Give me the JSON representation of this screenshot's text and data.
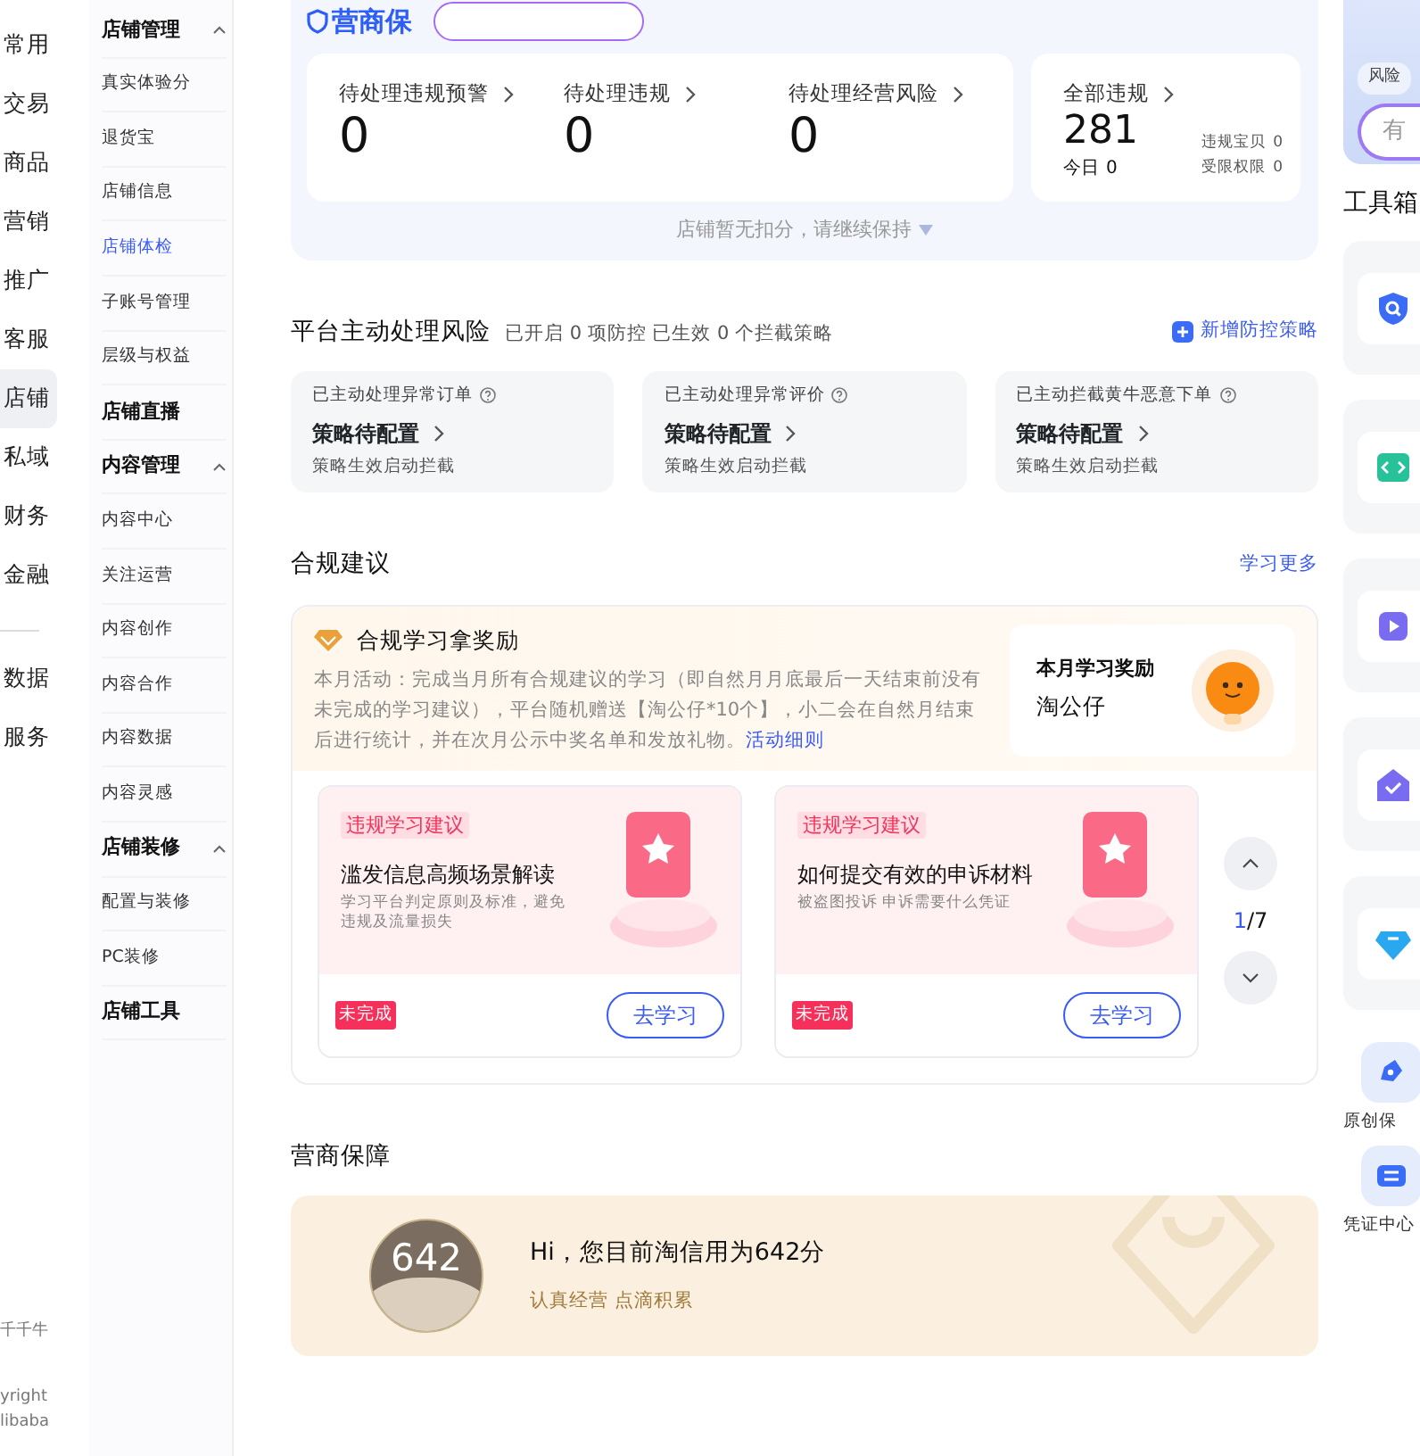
{
  "primary_nav": {
    "main": [
      {
        "label": "常用",
        "selected": false
      },
      {
        "label": "交易",
        "selected": false
      },
      {
        "label": "商品",
        "selected": false
      },
      {
        "label": "营销",
        "selected": false
      },
      {
        "label": "推广",
        "selected": false
      },
      {
        "label": "客服",
        "selected": false
      },
      {
        "label": "店铺",
        "selected": true
      },
      {
        "label": "私域",
        "selected": false
      },
      {
        "label": "财务",
        "selected": false
      },
      {
        "label": "金融",
        "selected": false
      }
    ],
    "extra": [
      {
        "label": "数据",
        "selected": false
      },
      {
        "label": "服务",
        "selected": false
      }
    ],
    "footer": {
      "app": "千千牛",
      "copyright_lines": [
        "yright",
        "libaba"
      ]
    }
  },
  "secondary_nav": [
    {
      "label": "店铺管理",
      "kind": "group",
      "expanded": true,
      "children": [
        {
          "label": "真实体验分",
          "selected": false
        },
        {
          "label": "退货宝",
          "selected": false
        },
        {
          "label": "店铺信息",
          "selected": false
        },
        {
          "label": "店铺体检",
          "selected": true
        },
        {
          "label": "子账号管理",
          "selected": false
        },
        {
          "label": "层级与权益",
          "selected": false
        }
      ]
    },
    {
      "label": "店铺直播",
      "kind": "link"
    },
    {
      "label": "内容管理",
      "kind": "group",
      "expanded": true,
      "children": [
        {
          "label": "内容中心",
          "selected": false
        },
        {
          "label": "关注运营",
          "selected": false
        },
        {
          "label": "内容创作",
          "selected": false
        },
        {
          "label": "内容合作",
          "selected": false
        },
        {
          "label": "内容数据",
          "selected": false
        },
        {
          "label": "内容灵感",
          "selected": false
        }
      ]
    },
    {
      "label": "店铺装修",
      "kind": "group",
      "expanded": true,
      "children": [
        {
          "label": "配置与装修",
          "selected": false
        },
        {
          "label": "PC装修",
          "selected": false
        }
      ]
    },
    {
      "label": "店铺工具",
      "kind": "link"
    }
  ],
  "header": {
    "logo": "营商保"
  },
  "violations": {
    "items": [
      {
        "label": "待处理违规预警",
        "value": "0"
      },
      {
        "label": "待处理违规",
        "value": "0"
      },
      {
        "label": "待处理经营风险",
        "value": "0"
      }
    ],
    "total": {
      "label": "全部违规",
      "value": "281",
      "today_label": "今日",
      "today_value": "0",
      "stats": [
        {
          "label": "违规宝贝",
          "value": "0"
        },
        {
          "label": "受限权限",
          "value": "0"
        }
      ]
    },
    "note": "店铺暂无扣分，请继续保持"
  },
  "risk": {
    "title": "平台主动处理风险",
    "summary": "已开启 0 项防控 已生效 0 个拦截策略",
    "action": "新增防控策略",
    "cards": [
      {
        "label": "已主动处理异常订单",
        "status": "策略待配置",
        "hint": "策略生效启动拦截"
      },
      {
        "label": "已主动处理异常评价",
        "status": "策略待配置",
        "hint": "策略生效启动拦截"
      },
      {
        "label": "已主动拦截黄牛恶意下单",
        "status": "策略待配置",
        "hint": "策略生效启动拦截"
      }
    ]
  },
  "compliance": {
    "title": "合规建议",
    "more": "学习更多",
    "promo": {
      "title": "合规学习拿奖励",
      "text": "本月活动：完成当月所有合规建议的学习（即自然月月底最后一天结束前没有未完成的学习建议），平台随机赠送【淘公仔*10个】，小二会在自然月结束后进行统计，并在次月公示中奖名单和发放礼物。",
      "link": "活动细则",
      "reward_label": "本月学习奖励",
      "reward": "淘公仔"
    },
    "cards": [
      {
        "tag": "违规学习建议",
        "title": "滥发信息高频场景解读",
        "desc": "学习平台判定原则及标准，避免违规及流量损失",
        "status": "未完成",
        "button": "去学习"
      },
      {
        "tag": "违规学习建议",
        "title": "如何提交有效的申诉材料",
        "desc": "被盗图投诉 申诉需要什么凭证",
        "status": "未完成",
        "button": "去学习"
      }
    ],
    "pager": {
      "current": "1",
      "total": "/7"
    }
  },
  "guarantee": {
    "title": "营商保障",
    "score": "642",
    "headline": "Hi，您目前淘信用为642分",
    "slogan": "认真经营 点滴积累"
  },
  "right_panel": {
    "chip": "风险",
    "pill": "有",
    "toolbox_title": "工具箱",
    "tools": [
      {
        "kind": "shield"
      },
      {
        "kind": "code"
      },
      {
        "kind": "play"
      },
      {
        "kind": "house"
      },
      {
        "kind": "tag"
      }
    ],
    "shortcuts": [
      {
        "label": "原创保",
        "kind": "pen"
      },
      {
        "label": "凭证中心",
        "kind": "ticket"
      }
    ]
  }
}
